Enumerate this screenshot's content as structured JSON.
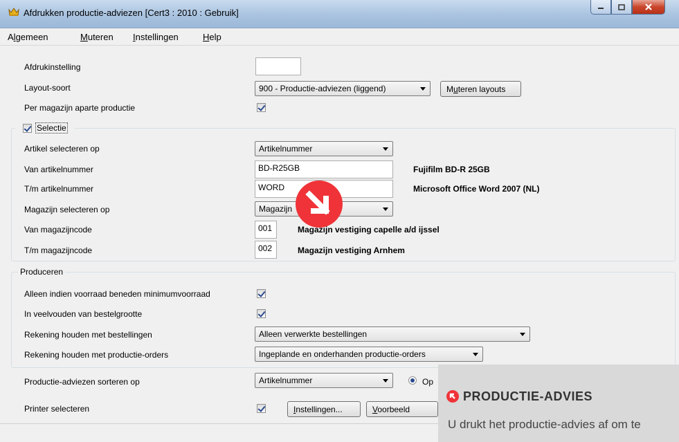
{
  "window": {
    "title": "Afdrukken productie-adviezen  [Cert3 : 2010 : Gebruik]",
    "icon": "crown-app-icon",
    "caption_buttons": {
      "minimize": "minimize-icon",
      "maximize": "maximize-icon",
      "close": "close-icon"
    }
  },
  "menu": [
    {
      "pre": "A",
      "ul": "l",
      "post": "gemeen"
    },
    {
      "pre": "",
      "ul": "M",
      "post": "uteren"
    },
    {
      "pre": "",
      "ul": "I",
      "post": "nstellingen"
    },
    {
      "pre": "",
      "ul": "H",
      "post": "elp"
    }
  ],
  "general": {
    "afdrukinstelling_label": "Afdrukinstelling",
    "afdrukinstelling_value": "",
    "layout_label": "Layout-soort",
    "layout_value": "900 - Productie-adviezen (liggend)",
    "muteren_layouts_pre": "M",
    "muteren_layouts_ul": "u",
    "muteren_layouts_post": "teren layouts",
    "per_magazijn_label": "Per magazijn aparte productie",
    "per_magazijn_checked": true
  },
  "selectie": {
    "group_label": "Selectie",
    "checked": true,
    "artikel_select_label": "Artikel selecteren op",
    "artikel_select_value": "Artikelnummer",
    "van_artikel_label": "Van artikelnummer",
    "van_artikel_value": "BD-R25GB",
    "van_artikel_desc": "Fujifilm BD-R 25GB",
    "tm_artikel_label": "T/m artikelnummer",
    "tm_artikel_value": "WORD",
    "tm_artikel_desc": "Microsoft Office Word 2007 (NL)",
    "magazijn_select_label": "Magazijn selecteren op",
    "magazijn_select_value": "Magazijn",
    "van_magazijn_label": "Van magazijncode",
    "van_magazijn_value": "001",
    "van_magazijn_desc": "Magazijn vestiging capelle a/d ijssel",
    "tm_magazijn_label": "T/m magazijncode",
    "tm_magazijn_value": "002",
    "tm_magazijn_desc": "Magazijn vestiging Arnhem"
  },
  "produceren": {
    "group_label": "Produceren",
    "voorraad_label": "Alleen indien voorraad beneden minimumvoorraad",
    "voorraad_checked": true,
    "veelvouden_label": "In veelvouden van bestelgrootte",
    "veelvouden_checked": true,
    "bestellingen_label": "Rekening houden met bestellingen",
    "bestellingen_value": "Alleen verwerkte bestellingen",
    "productieorders_label": "Rekening houden met productie-orders",
    "productieorders_value": "Ingeplande en onderhanden productie-orders"
  },
  "footer": {
    "sorteren_label": "Productie-adviezen sorteren op",
    "sorteren_value": "Artikelnummer",
    "sort_radio_label": "Op",
    "sort_radio_selected": true,
    "printer_label": "Printer selecteren",
    "printer_checked": true,
    "instellingen_pre": "",
    "instellingen_ul": "I",
    "instellingen_post": "nstellingen...",
    "voorbeeld_pre": "",
    "voorbeeld_ul": "V",
    "voorbeeld_post": "oorbeeld"
  },
  "overlay": {
    "arrow_icon": "arrow-down-right-icon",
    "arrow_color": "#ef3338",
    "panel_icon": "arrow-up-left-icon",
    "panel_title": "PRODUCTIE-ADVIES",
    "panel_text": "U drukt het productie-advies af om te"
  }
}
